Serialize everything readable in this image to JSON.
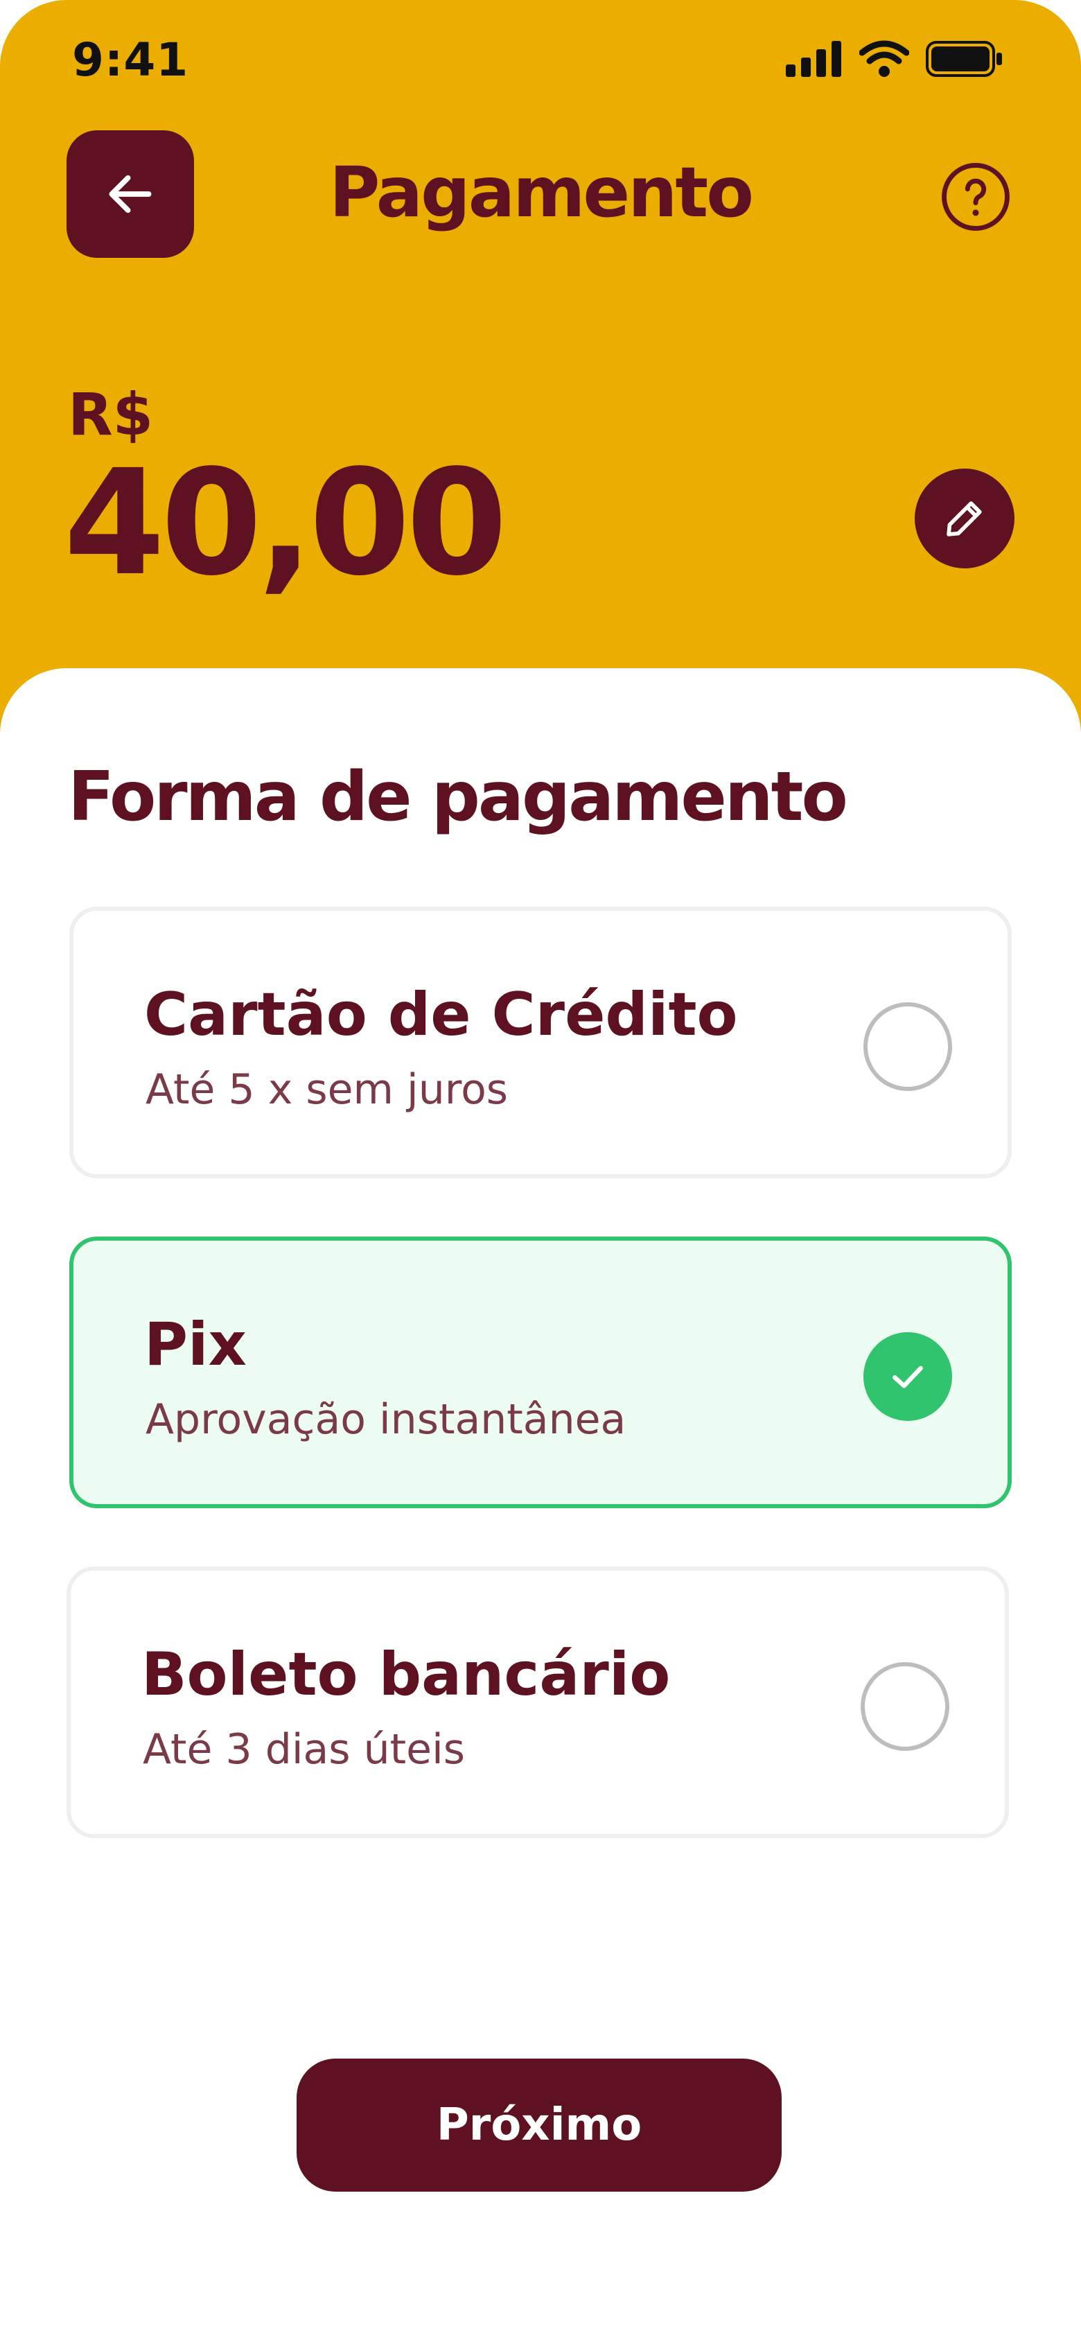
{
  "status_bar": {
    "time": "9:41",
    "icons": [
      "signal-icon",
      "wifi-icon",
      "battery-icon"
    ]
  },
  "header": {
    "back_icon": "arrow-left-icon",
    "title": "Pagamento",
    "help_icon": "question-circle-icon",
    "currency": "R$",
    "amount": "40,00",
    "edit_icon": "pencil-icon"
  },
  "payment": {
    "section_title": "Forma de pagamento",
    "options": [
      {
        "title": "Cartão de Crédito",
        "subtitle": "Até 5 x sem juros",
        "selected": false
      },
      {
        "title": "Pix",
        "subtitle": "Aprovação instantânea",
        "selected": true
      },
      {
        "title": "Boleto bancário",
        "subtitle": "Até 3 dias úteis",
        "selected": false
      }
    ]
  },
  "footer": {
    "next_label": "Próximo"
  },
  "colors": {
    "header_background": "#ebae00",
    "primary": "#5e1120",
    "selected_border": "#2fc46d",
    "selected_background": "#edfcf2",
    "radio_border": "#bdbdbd"
  }
}
